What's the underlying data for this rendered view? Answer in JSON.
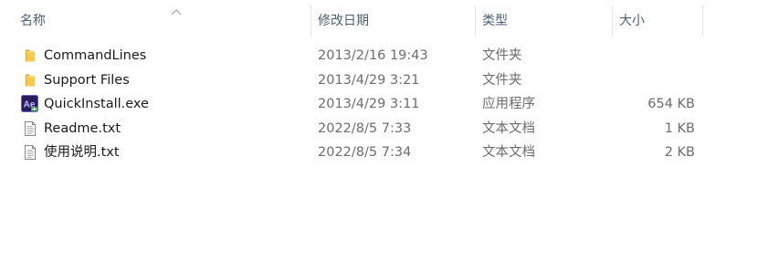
{
  "columns": {
    "name": "名称",
    "modified": "修改日期",
    "type": "类型",
    "size": "大小"
  },
  "files": [
    {
      "name": "CommandLines",
      "modified": "2013/2/16 19:43",
      "type": "文件夹",
      "size": "",
      "icon": "folder-icon"
    },
    {
      "name": "Support Files",
      "modified": "2013/4/29 3:21",
      "type": "文件夹",
      "size": "",
      "icon": "folder-icon"
    },
    {
      "name": "QuickInstall.exe",
      "modified": "2013/4/29 3:11",
      "type": "应用程序",
      "size": "654 KB",
      "icon": "adobe-media-encoder-app-icon"
    },
    {
      "name": "Readme.txt",
      "modified": "2022/8/5 7:33",
      "type": "文本文档",
      "size": "1 KB",
      "icon": "text-document-icon"
    },
    {
      "name": "使用说明.txt",
      "modified": "2022/8/5 7:34",
      "type": "文本文档",
      "size": "2 KB",
      "icon": "text-document-icon"
    }
  ],
  "app_icon_text": "Ae",
  "colors": {
    "header_text": "#4c607a",
    "folder": "#f8c94a",
    "secondary_text": "#6d6d6d"
  }
}
